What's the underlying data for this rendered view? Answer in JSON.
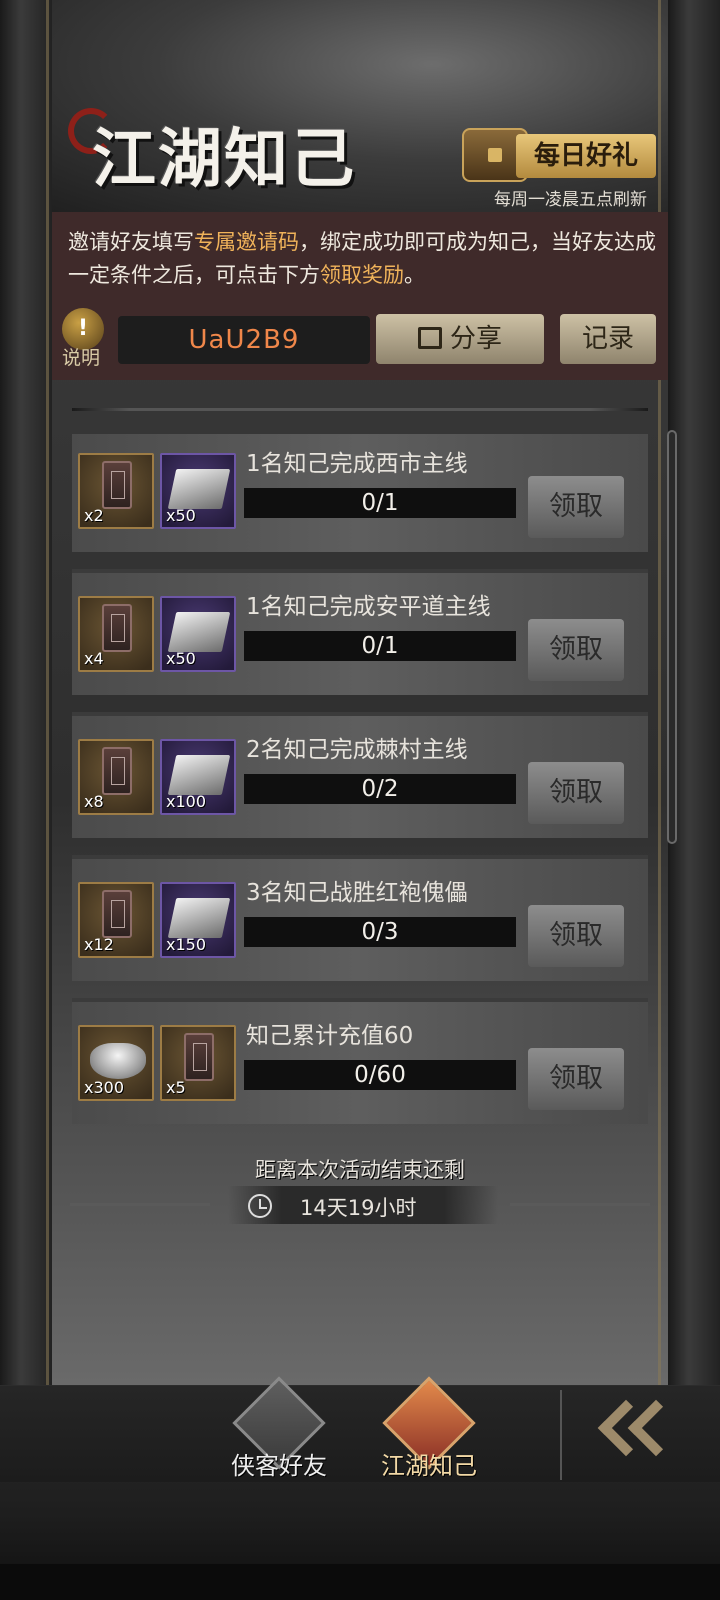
{
  "header": {
    "title": "江湖知己",
    "daily_gift_label": "每日好礼",
    "refresh_note": "每周一凌晨五点刷新"
  },
  "invite": {
    "desc_part1": "邀请好友填写",
    "desc_hl1": "专属邀请码",
    "desc_part2": "，绑定成功即可成为知己，当好友达成一定条件之后，可点击下方",
    "desc_hl2": "领取奖励",
    "desc_part3": "。",
    "help_icon": "!",
    "help_label": "说明",
    "code": "UaU2B9",
    "share_label": "分享",
    "record_label": "记录"
  },
  "tasks": [
    {
      "name": "1名知己完成西市主线",
      "progress_text": "0/1",
      "progress": 0,
      "rewards": [
        {
          "icon": "token-icon",
          "qty": "x2",
          "frame": "gold"
        },
        {
          "icon": "silver-bar-icon",
          "qty": "x50",
          "frame": "purple"
        }
      ],
      "claim_label": "领取"
    },
    {
      "name": "1名知己完成安平道主线",
      "progress_text": "0/1",
      "progress": 0,
      "rewards": [
        {
          "icon": "token-icon",
          "qty": "x4",
          "frame": "gold"
        },
        {
          "icon": "silver-bar-icon",
          "qty": "x50",
          "frame": "purple"
        }
      ],
      "claim_label": "领取"
    },
    {
      "name": "2名知己完成棘村主线",
      "progress_text": "0/2",
      "progress": 0,
      "rewards": [
        {
          "icon": "token-icon",
          "qty": "x8",
          "frame": "gold"
        },
        {
          "icon": "silver-bar-icon",
          "qty": "x100",
          "frame": "purple"
        }
      ],
      "claim_label": "领取"
    },
    {
      "name": "3名知己战胜红袍傀儡",
      "progress_text": "0/3",
      "progress": 0,
      "rewards": [
        {
          "icon": "token-icon",
          "qty": "x12",
          "frame": "gold"
        },
        {
          "icon": "silver-bar-icon",
          "qty": "x150",
          "frame": "purple"
        }
      ],
      "claim_label": "领取"
    },
    {
      "name": "知己累计充值60",
      "progress_text": "0/60",
      "progress": 0,
      "rewards": [
        {
          "icon": "silver-ingot-icon",
          "qty": "x300",
          "frame": "gold"
        },
        {
          "icon": "token-icon",
          "qty": "x5",
          "frame": "gold"
        }
      ],
      "claim_label": "领取"
    }
  ],
  "countdown": {
    "label": "距离本次活动结束还剩",
    "value": "14天19小时"
  },
  "nav": {
    "friends_label": "侠客好友",
    "jianghu_label": "江湖知己"
  },
  "colors": {
    "highlight": "#f0b35a",
    "code": "#f0874a",
    "invite_panel": "#3f2a2a",
    "gift_gold": "#e8c77a"
  }
}
